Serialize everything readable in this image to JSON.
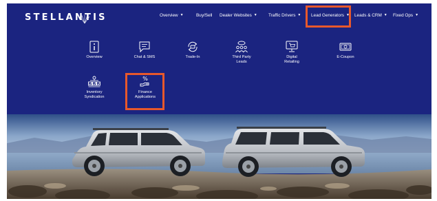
{
  "brand": {
    "name": "STELLANTIS"
  },
  "nav": {
    "items": [
      {
        "label": "Overview",
        "dropdown": true
      },
      {
        "label": "Buy/Sell",
        "dropdown": false
      },
      {
        "label": "Dealer Websites",
        "dropdown": true
      },
      {
        "label": "Traffic Drivers",
        "dropdown": true
      },
      {
        "label": "Lead Generators",
        "dropdown": true,
        "active": true
      },
      {
        "label": "Leads & CRM",
        "dropdown": true
      },
      {
        "label": "Fixed Ops",
        "dropdown": true
      }
    ],
    "caret_glyph": "▼"
  },
  "lead_generators_menu": {
    "items": [
      {
        "label": "Overview",
        "icon": "info-icon"
      },
      {
        "label": "Chat & SMS",
        "icon": "chat-icon"
      },
      {
        "label": "Trade-In",
        "icon": "trade-in-icon"
      },
      {
        "label": "Third Party Leads",
        "icon": "third-party-leads-icon"
      },
      {
        "label": "Digital Retailing",
        "icon": "digital-retailing-icon"
      },
      {
        "label": "E-Coupon",
        "icon": "coupon-icon"
      },
      {
        "label": "Inventory Syndication",
        "icon": "inventory-syndication-icon"
      },
      {
        "label": "Finance Applications",
        "icon": "finance-applications-icon",
        "highlighted": true
      }
    ]
  },
  "colors": {
    "nav_background": "#1b2480",
    "highlight": "#e8582b",
    "text": "#ffffff"
  },
  "hero": {
    "image": "two silver Jeep Grand Wagoneer SUVs parked on a desert lake shore"
  }
}
